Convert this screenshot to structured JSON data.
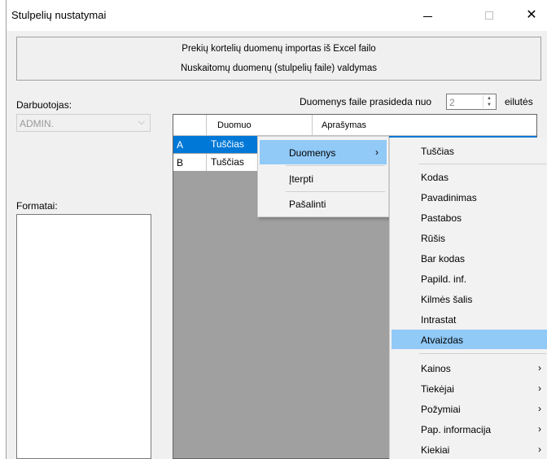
{
  "window": {
    "title": "Stulpelių nustatymai",
    "minimize": "—",
    "close": "✕"
  },
  "header": {
    "line1": "Prekių kortelių duomenų importas iš Excel failo",
    "line2": "Nuskaitomų duomenų (stulpelių faile) valdymas"
  },
  "employee": {
    "label": "Darbuotojas:",
    "value": "ADMIN."
  },
  "formats": {
    "label": "Formatai:"
  },
  "start_row": {
    "label": "Duomenys faile prasideda nuo",
    "value": "2",
    "suffix": "eilutės"
  },
  "grid": {
    "columns": [
      "Duomuo",
      "Aprašymas"
    ],
    "rows": [
      {
        "letter": "A",
        "data": "Tuščias",
        "selected": true
      },
      {
        "letter": "B",
        "data": "Tuščias",
        "selected": false
      }
    ]
  },
  "context_menu": {
    "items": [
      {
        "label": "Duomenys",
        "submenu": true,
        "highlighted": true
      },
      {
        "label": "Įterpti",
        "submenu": false
      },
      {
        "label": "Pašalinti",
        "submenu": false
      }
    ]
  },
  "submenu": {
    "items": [
      {
        "label": "Tuščias"
      },
      {
        "label": "Kodas"
      },
      {
        "label": "Pavadinimas"
      },
      {
        "label": "Pastabos"
      },
      {
        "label": "Rūšis"
      },
      {
        "label": "Bar kodas"
      },
      {
        "label": "Papild. inf."
      },
      {
        "label": "Kilmės šalis"
      },
      {
        "label": "Intrastat"
      },
      {
        "label": "Atvaizdas",
        "highlighted": true
      },
      {
        "label": "Kainos",
        "submenu": true
      },
      {
        "label": "Tiekėjai",
        "submenu": true
      },
      {
        "label": "Požymiai",
        "submenu": true
      },
      {
        "label": "Pap. informacija",
        "submenu": true
      },
      {
        "label": "Kiekiai",
        "submenu": true
      }
    ],
    "arrow": "›"
  },
  "colors": {
    "selection": "#0078d7",
    "menu_highlight": "#91c9f7",
    "grid_background": "#a0a0a0"
  }
}
